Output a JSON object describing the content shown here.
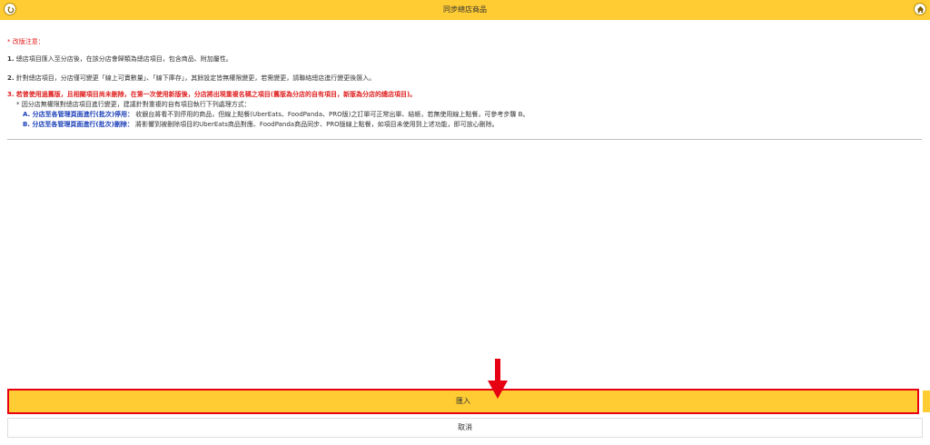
{
  "header": {
    "title": "同步總店商品",
    "back_icon": "back-arrow-icon",
    "home_icon": "home-icon",
    "bar_color": "#ffcc33"
  },
  "notice": {
    "title": "* 改版注意：",
    "item1_num": "1.",
    "item1_text": "總店項目匯入至分店後，在該分店會歸類為總店項目，包含商品、附加屬性。",
    "item2_num": "2.",
    "item2_text": "針對總店項目，分店僅可變更「線上可賣數量」、「線下庫存」，其餘設定皆無權限變更，若需變更，請聯絡總店進行變更後匯入。",
    "item3_num": "3.",
    "item3_text": "若曾使用過舊版，且相關項目尚未刪除，在第一次使用新版後，分店將出現重複名稱之項目(舊版為分店的自有項目，新版為分店的總店項目)。",
    "item3_sub": "* 因分店無權限對總店項目進行變更，建議針對重複的自有項目執行下列處理方式：",
    "option_a_label": "A. 分店至各管理頁面進行(批次)停用：",
    "option_a_text": "收銀台將看不到停用的商品，但線上點餐(UberEats、FoodPanda、PRO版)之訂單可正常出單、結帳，若無使用線上點餐，可參考步驟 B。",
    "option_b_label": "B. 分店至各管理頁面進行(批次)刪除：",
    "option_b_text": "將影響到被刪除項目的UberEats商品對應、FoodPanda商品同步、PRO版線上點餐，如項目未使用到上述功能，即可放心刪除。"
  },
  "actions": {
    "import_label": "匯入",
    "cancel_label": "取消"
  },
  "colors": {
    "accent": "#ffcc33",
    "warning_red": "#e02020",
    "option_blue": "#1a3fb8",
    "highlight_border": "#e60012"
  }
}
